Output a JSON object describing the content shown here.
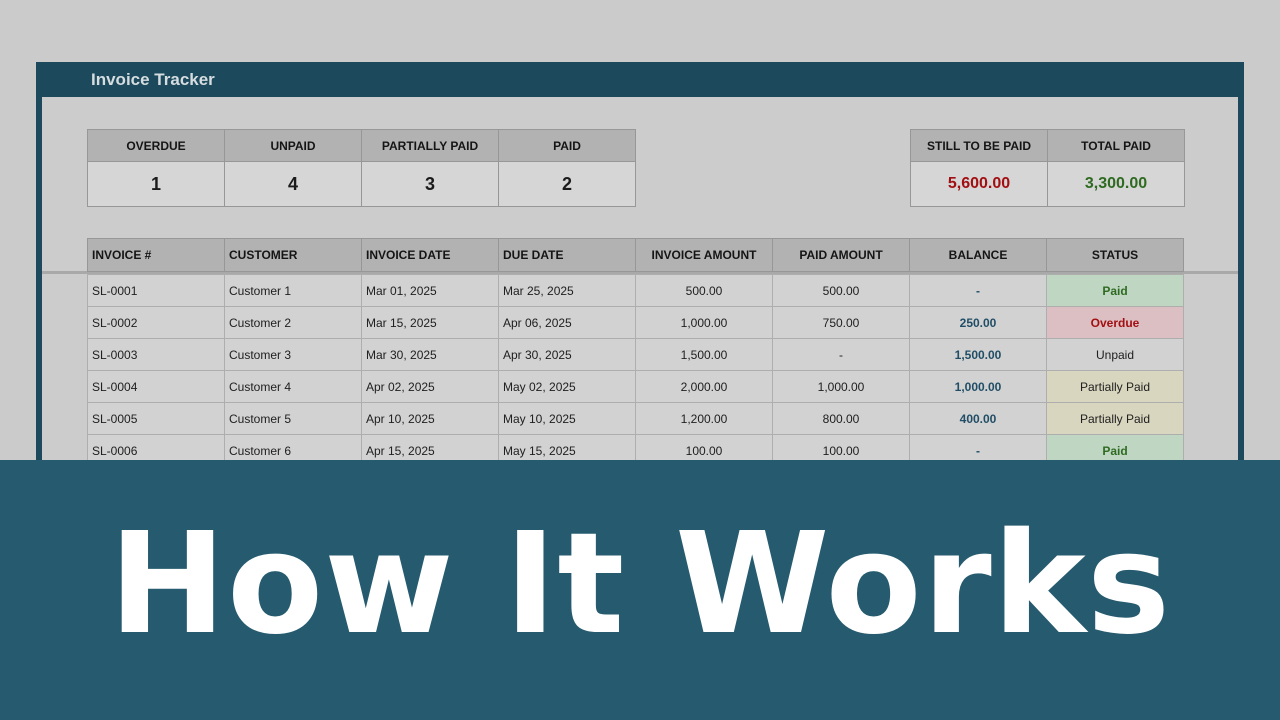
{
  "app": {
    "title": "Invoice Tracker"
  },
  "summary": {
    "headers": [
      "OVERDUE",
      "UNPAID",
      "PARTIALLY PAID",
      "PAID"
    ],
    "values": [
      "1",
      "4",
      "3",
      "2"
    ]
  },
  "totals": {
    "headers": [
      "STILL TO BE PAID",
      "TOTAL PAID"
    ],
    "values": [
      "5,600.00",
      "3,300.00"
    ]
  },
  "table": {
    "columns": [
      "INVOICE #",
      "CUSTOMER",
      "INVOICE DATE",
      "DUE DATE",
      "INVOICE AMOUNT",
      "PAID AMOUNT",
      "BALANCE",
      "STATUS"
    ],
    "rows": [
      [
        "SL-0001",
        "Customer 1",
        "Mar 01, 2025",
        "Mar 25, 2025",
        "500.00",
        "500.00",
        "-",
        "Paid"
      ],
      [
        "SL-0002",
        "Customer 2",
        "Mar 15, 2025",
        "Apr 06, 2025",
        "1,000.00",
        "750.00",
        "250.00",
        "Overdue"
      ],
      [
        "SL-0003",
        "Customer 3",
        "Mar 30, 2025",
        "Apr 30, 2025",
        "1,500.00",
        "-",
        "1,500.00",
        "Unpaid"
      ],
      [
        "SL-0004",
        "Customer 4",
        "Apr 02, 2025",
        "May 02, 2025",
        "2,000.00",
        "1,000.00",
        "1,000.00",
        "Partially Paid"
      ],
      [
        "SL-0005",
        "Customer 5",
        "Apr 10, 2025",
        "May 10, 2025",
        "1,200.00",
        "800.00",
        "400.00",
        "Partially Paid"
      ],
      [
        "SL-0006",
        "Customer 6",
        "Apr 15, 2025",
        "May 15, 2025",
        "100.00",
        "100.00",
        "-",
        "Paid"
      ]
    ]
  },
  "banner": {
    "text": "How It Works"
  },
  "colors": {
    "frame": "#1c4a5c",
    "banner": "#265b6f",
    "overdue": "#a20f13",
    "paid": "#2e6b21",
    "balance": "#214e66"
  }
}
